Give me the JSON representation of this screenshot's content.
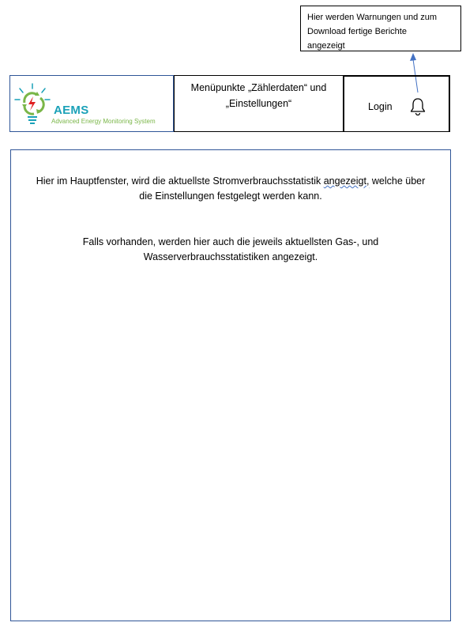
{
  "callout": {
    "line1": "Hier werden Warnungen und zum",
    "line2": "Download fertige Berichte",
    "line3": "angezeigt"
  },
  "logo": {
    "title": "AEMS",
    "subtitle": "Advanced Energy Monitoring System"
  },
  "menu": {
    "line1": "Menüpunkte „Zählerdaten“ und",
    "line2": "„Einstellungen“"
  },
  "login": {
    "label": "Login",
    "icon": "bell-icon"
  },
  "main": {
    "p1_line1a": "Hier im Hauptfenster, wird die aktuellste Stromverbrauchsstatistik ",
    "p1_line1b": "angezeigt,",
    "p1_line1c": "  welche über",
    "p1_line2": "die Einstellungen festgelegt werden kann.",
    "p2_line1": "Falls vorhanden, werden hier auch die jeweils aktuellsten Gas-, und",
    "p2_line2": "Wasserverbrauchsstatistiken angezeigt."
  },
  "colors": {
    "frame_blue": "#2f5597",
    "arrow_blue": "#4472c4",
    "logo_teal": "#1aa1b8",
    "logo_green": "#7ab648"
  }
}
